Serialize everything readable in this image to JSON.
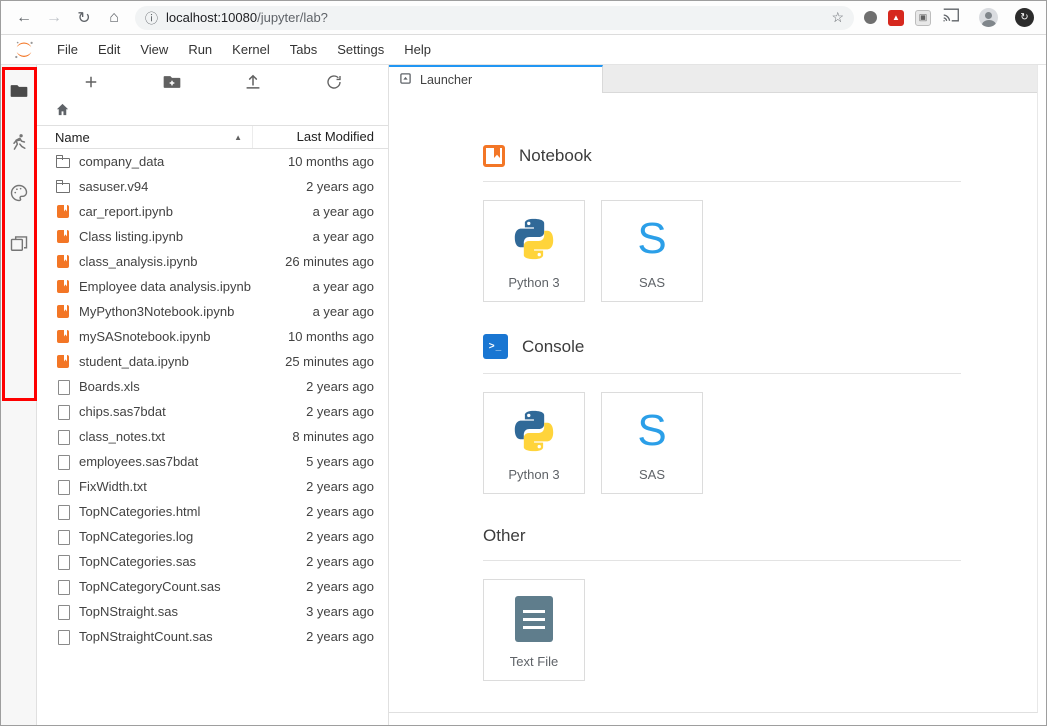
{
  "browser": {
    "back": "←",
    "forward": "→",
    "reload": "↻",
    "home": "⌂",
    "info_icon": "ⓘ",
    "url_host": "localhost:10080",
    "url_path": "/jupyter/lab?",
    "star_icon": "☆"
  },
  "menubar": {
    "items": [
      "File",
      "Edit",
      "View",
      "Run",
      "Kernel",
      "Tabs",
      "Settings",
      "Help"
    ]
  },
  "filebrowser": {
    "columns": {
      "name": "Name",
      "modified": "Last Modified"
    },
    "sort_ascending": "▲",
    "files": [
      {
        "name": "company_data",
        "type": "folder",
        "modified": "10 months ago"
      },
      {
        "name": "sasuser.v94",
        "type": "folder",
        "modified": "2 years ago"
      },
      {
        "name": "car_report.ipynb",
        "type": "notebook",
        "modified": "a year ago"
      },
      {
        "name": "Class listing.ipynb",
        "type": "notebook",
        "modified": "a year ago"
      },
      {
        "name": "class_analysis.ipynb",
        "type": "notebook",
        "modified": "26 minutes ago"
      },
      {
        "name": "Employee data analysis.ipynb",
        "type": "notebook",
        "modified": "a year ago"
      },
      {
        "name": "MyPython3Notebook.ipynb",
        "type": "notebook",
        "modified": "a year ago"
      },
      {
        "name": "mySASnotebook.ipynb",
        "type": "notebook",
        "modified": "10 months ago"
      },
      {
        "name": "student_data.ipynb",
        "type": "notebook",
        "modified": "25 minutes ago"
      },
      {
        "name": "Boards.xls",
        "type": "file",
        "modified": "2 years ago"
      },
      {
        "name": "chips.sas7bdat",
        "type": "file",
        "modified": "2 years ago"
      },
      {
        "name": "class_notes.txt",
        "type": "file",
        "modified": "8 minutes ago"
      },
      {
        "name": "employees.sas7bdat",
        "type": "file",
        "modified": "5 years ago"
      },
      {
        "name": "FixWidth.txt",
        "type": "file",
        "modified": "2 years ago"
      },
      {
        "name": "TopNCategories.html",
        "type": "file",
        "modified": "2 years ago"
      },
      {
        "name": "TopNCategories.log",
        "type": "file",
        "modified": "2 years ago"
      },
      {
        "name": "TopNCategories.sas",
        "type": "file",
        "modified": "2 years ago"
      },
      {
        "name": "TopNCategoryCount.sas",
        "type": "file",
        "modified": "2 years ago"
      },
      {
        "name": "TopNStraight.sas",
        "type": "file",
        "modified": "3 years ago"
      },
      {
        "name": "TopNStraightCount.sas",
        "type": "file",
        "modified": "2 years ago"
      }
    ]
  },
  "launcher": {
    "tab_label": "Launcher",
    "console_prompt": ">_",
    "sas_letter": "S",
    "sections": [
      {
        "title": "Notebook",
        "cards": [
          {
            "label": "Python 3"
          },
          {
            "label": "SAS"
          }
        ]
      },
      {
        "title": "Console",
        "cards": [
          {
            "label": "Python 3"
          },
          {
            "label": "SAS"
          }
        ]
      },
      {
        "title": "Other",
        "cards": [
          {
            "label": "Text File"
          }
        ]
      }
    ]
  },
  "colors": {
    "jupyter_orange": "#f37626",
    "sas_blue": "#2b9fe8",
    "tab_accent": "#2196f3",
    "annotation_red": "#fe0000"
  }
}
